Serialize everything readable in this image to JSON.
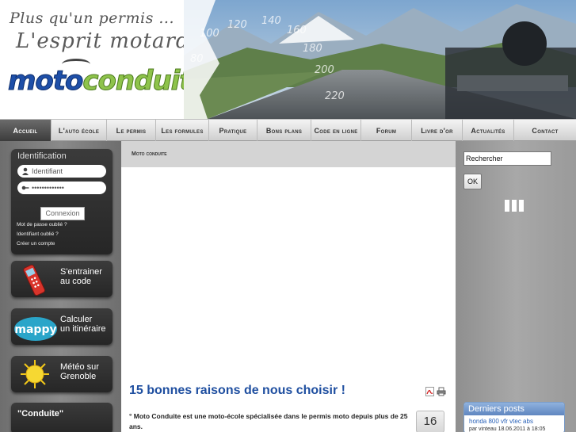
{
  "header": {
    "tagline_line1": "Plus qu'un permis ...",
    "tagline_line2": "L'esprit motard",
    "brand_part1": "moto",
    "brand_part2": "conduite",
    "speedo_labels": [
      "80",
      "100",
      "120",
      "140",
      "160",
      "180",
      "200",
      "220"
    ]
  },
  "nav": {
    "items": [
      {
        "label": "Accueil"
      },
      {
        "label": "L'auto école"
      },
      {
        "label": "Le permis"
      },
      {
        "label": "Les formules"
      },
      {
        "label": "Pratique"
      },
      {
        "label": "Bons plans"
      },
      {
        "label": "Code en ligne"
      },
      {
        "label": "Forum"
      },
      {
        "label": "Livre d'or"
      },
      {
        "label": "Actualités"
      },
      {
        "label": "Contact"
      }
    ]
  },
  "login": {
    "title": "Identification",
    "username_placeholder": "Identifiant",
    "password_value": "•••••••••••••",
    "submit_label": "Connexion",
    "forgot_password": "Mot de passe oublié ?",
    "forgot_username": "Identifiant oublié ?",
    "create_account": "Créer un compte"
  },
  "promos": {
    "code": {
      "line1": "S'entrainer",
      "line2": "au code"
    },
    "mappy": {
      "logo": "mappy",
      "line1": "Calculer",
      "line2": "un itinéraire"
    },
    "meteo": {
      "line1": "Météo sur",
      "line2": "Grenoble"
    }
  },
  "conduite_box": {
    "title": "\"Conduite\""
  },
  "main": {
    "breadcrumb": "Moto conduite",
    "article_title": "15 bonnes raisons de nous choisir !",
    "article_text": "° Moto Conduite est une moto-école spécialisée dans le permis moto depuis plus de 25 ans.",
    "date_day": "16"
  },
  "sidebar_right": {
    "search_value": "Rechercher",
    "ok_label": "OK",
    "posts_title": "Derniers posts",
    "post_link": "honda 800 vfr vtec abs",
    "post_meta": "par vinteau 18.06.2011 à 18:05"
  },
  "colors": {
    "brand_blue": "#1e4fa8",
    "brand_green": "#8ec34b",
    "title_blue": "#1f4fa0",
    "nav_active": "#4a4a4a"
  }
}
